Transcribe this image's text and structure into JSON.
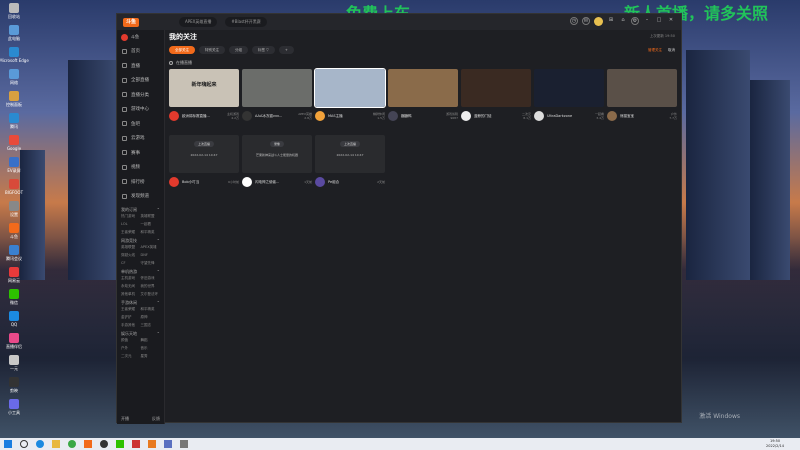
{
  "overlay": {
    "left": "免费上车",
    "right": "新人首播，请多关照"
  },
  "desktop_icons": [
    "回收站",
    "此电脑",
    "Microsoft Edge",
    "网络",
    "控制面板",
    "腾讯",
    "Google",
    "EV录屏",
    "BIGFOOT",
    "设置",
    "斗鱼",
    "腾讯会议",
    "网易云",
    "微信",
    "QQ",
    "直播伴侣",
    "一元",
    "剪映",
    "小工具"
  ],
  "window": {
    "app_logo": "斗鱼",
    "search_tab_1": "APEX英雄直播",
    "search_tab_2": "#Blast杯开黑赛",
    "sidebar": {
      "user": "斗鱼",
      "top": [
        "首页",
        "直播",
        "全部直播",
        "直播分类",
        "游戏中心",
        "鱼吧",
        "云游戏",
        "赛事",
        "视频",
        "排行榜",
        "发现频道"
      ],
      "sections": [
        {
          "title": "我的订阅",
          "items": [
            "热门游戏",
            "英雄联盟",
            "LOL",
            "一起看",
            "王者荣耀",
            "和平精英"
          ]
        },
        {
          "title": "网游竞技",
          "items": [
            "英雄联盟",
            "APEX英雄",
            "穿越火线",
            "DNF",
            "CF",
            "守望先锋"
          ]
        },
        {
          "title": "单机热游",
          "items": [
            "主机游戏",
            "怀旧游戏",
            "永劫无间",
            "我的世界",
            "其他单机",
            "艾尔登法环"
          ]
        },
        {
          "title": "手游休闲",
          "items": [
            "王者荣耀",
            "和平精英",
            "金铲铲",
            "原神",
            "手游其他",
            "三国志"
          ]
        },
        {
          "title": "娱乐天地",
          "items": [
            "颜值",
            "舞蹈",
            "户外",
            "音乐",
            "二次元",
            "星秀"
          ]
        }
      ],
      "footer_left": "开播",
      "footer_right": "反馈"
    },
    "main": {
      "title": "我的关注",
      "updated": "上次更新 19:50",
      "filters": [
        "全部关注",
        "特别关注",
        "分组",
        "标签 ▽",
        "+"
      ],
      "actions": [
        "管理关注",
        "取消"
      ],
      "subheader": "在播直播",
      "live_cards": [
        {
          "title": "新年嗨起来",
          "name": "欧洲锦标赛直播...",
          "sub": "主机游戏",
          "viewers": "4.2万",
          "thumb": "#c9c2b6",
          "avatar": "#e23a2d"
        },
        {
          "title": "",
          "name": "AAA冰冻猫vvv...",
          "sub": "APEX英雄",
          "viewers": "2.8万",
          "thumb": "#6b6d6a",
          "avatar": "#333"
        },
        {
          "title": "",
          "name": "MAS主播",
          "sub": "棋牌休闲",
          "viewers": "1.5万",
          "thumb": "#a7b6c9",
          "avatar": "#f2a23a"
        },
        {
          "title": "",
          "name": "蹦蹦鸭",
          "sub": "游戏剪辑",
          "viewers": "9687",
          "thumb": "#8a6b4a",
          "avatar": "#445"
        },
        {
          "title": "",
          "name": "蓝鲸的门徒",
          "sub": "二次元",
          "viewers": "8.1万",
          "thumb": "#3a2a22",
          "avatar": "#eee"
        },
        {
          "title": "",
          "name": "UltraDarkzone",
          "sub": "一起看",
          "viewers": "3.4万",
          "thumb": "#1a2030",
          "avatar": "#ddd"
        },
        {
          "title": "",
          "name": "熊猫宝宝",
          "sub": "户外",
          "viewers": "7.7万",
          "thumb": "#5a5048",
          "avatar": "#8a6a4a"
        }
      ],
      "replay_cards": [
        {
          "label": "上次直播",
          "time": "2022-02-14 10:47",
          "name": "Bob小叮当",
          "sub": "6小时前",
          "thumb": "#2a2b2e",
          "avatar": "#e23a2d"
        },
        {
          "label": "录像",
          "time": "芒果新神来战斗人士能量的机器",
          "name": "闪电神之使者...",
          "sub": "1天前",
          "thumb": "#2a2b2e",
          "avatar": "#fff"
        },
        {
          "label": "上次直播",
          "time": "2022-02-14 10:47",
          "name": "Pe组合",
          "sub": "2天前",
          "thumb": "#2a2b2e",
          "avatar": "#5a4aa0"
        }
      ]
    }
  },
  "watermark": "激活 Windows",
  "taskbar": {
    "time": "19:50",
    "date": "2022/2/14"
  }
}
